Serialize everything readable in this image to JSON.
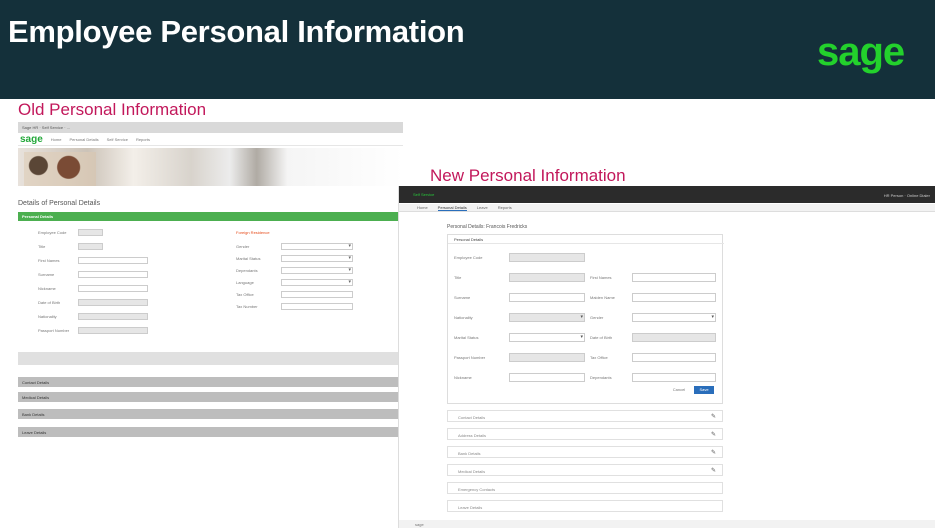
{
  "slide": {
    "title": "Employee Personal Information",
    "brand_logo": "sage",
    "old_section_title": "Old Personal Information",
    "new_section_title": "New Personal Information",
    "colors": {
      "header_bg": "#14303a",
      "brand_green": "#23d12c",
      "section_title": "#c2185b",
      "old_green_bar": "#4caf50",
      "new_accent": "#2a6ebb"
    }
  },
  "old": {
    "breadcrumb": "Sage HR · Self Service · ...",
    "logo": "sage",
    "nav": [
      "Home",
      "Personal Details",
      "Self Service",
      "Reports"
    ],
    "subheading": "Details of Personal Details",
    "green_bar": "Personal Details",
    "left_fields": [
      "Employee Code",
      "Title",
      "First Names",
      "Surname",
      "Nickname",
      "Date of Birth",
      "Nationality",
      "Passport Number"
    ],
    "right_heading": "Foreign Residence",
    "right_fields": [
      "Gender",
      "Marital Status",
      "Dependants",
      "Language",
      "Tax Office",
      "Tax Number"
    ],
    "accordions": [
      "Contact Details",
      "Medical Details",
      "Bank Details",
      "Leave Details"
    ]
  },
  "new": {
    "app_name": "Self Service",
    "user_menu": "HR Person · Online Dialer",
    "tabs": [
      "Home",
      "Personal Details",
      "Leave",
      "Reports"
    ],
    "page_title": "Personal Details: Francois Fredricks",
    "card_title": "Personal Details",
    "left_fields": [
      "Employee Code",
      "Title",
      "Surname",
      "Nationality",
      "Marital Status",
      "Passport Number",
      "Nickname"
    ],
    "right_fields": [
      "First Names",
      "Maiden Name",
      "Gender",
      "Date of Birth",
      "Tax Office",
      "Dependants"
    ],
    "cancel_label": "Cancel",
    "save_label": "Save",
    "sections": [
      "Contact Details",
      "Address Details",
      "Bank Details",
      "Medical Details",
      "Emergency Contacts",
      "Leave Details"
    ],
    "footer_logo": "sage"
  }
}
